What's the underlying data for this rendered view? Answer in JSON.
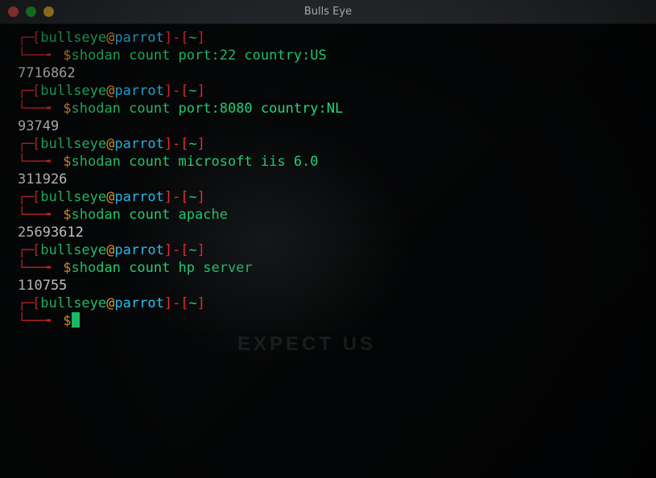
{
  "window": {
    "title": "Bulls Eye"
  },
  "colors": {
    "red": "#ff2b2b",
    "green": "#22dd7a",
    "cyan": "#29c8ff",
    "orange": "#ffa726"
  },
  "prompt": {
    "user": "bullseye",
    "at": "@",
    "host": "parrot",
    "cwd": "~",
    "open": "[",
    "close": "]",
    "sep_open": "-[",
    "sep_close": "]",
    "corner": "┌─",
    "elbow": "└──╼",
    "dollar": "$"
  },
  "blocks": [
    {
      "command": "shodan count port:22 country:US",
      "output": "7716862"
    },
    {
      "command": "shodan count port:8080 country:NL",
      "output": "93749"
    },
    {
      "command": "shodan count microsoft iis 6.0",
      "output": "311926"
    },
    {
      "command": "shodan count apache",
      "output": "25693612"
    },
    {
      "command": "shodan count hp server",
      "output": "110755"
    }
  ],
  "watermark": "EXPECT US"
}
